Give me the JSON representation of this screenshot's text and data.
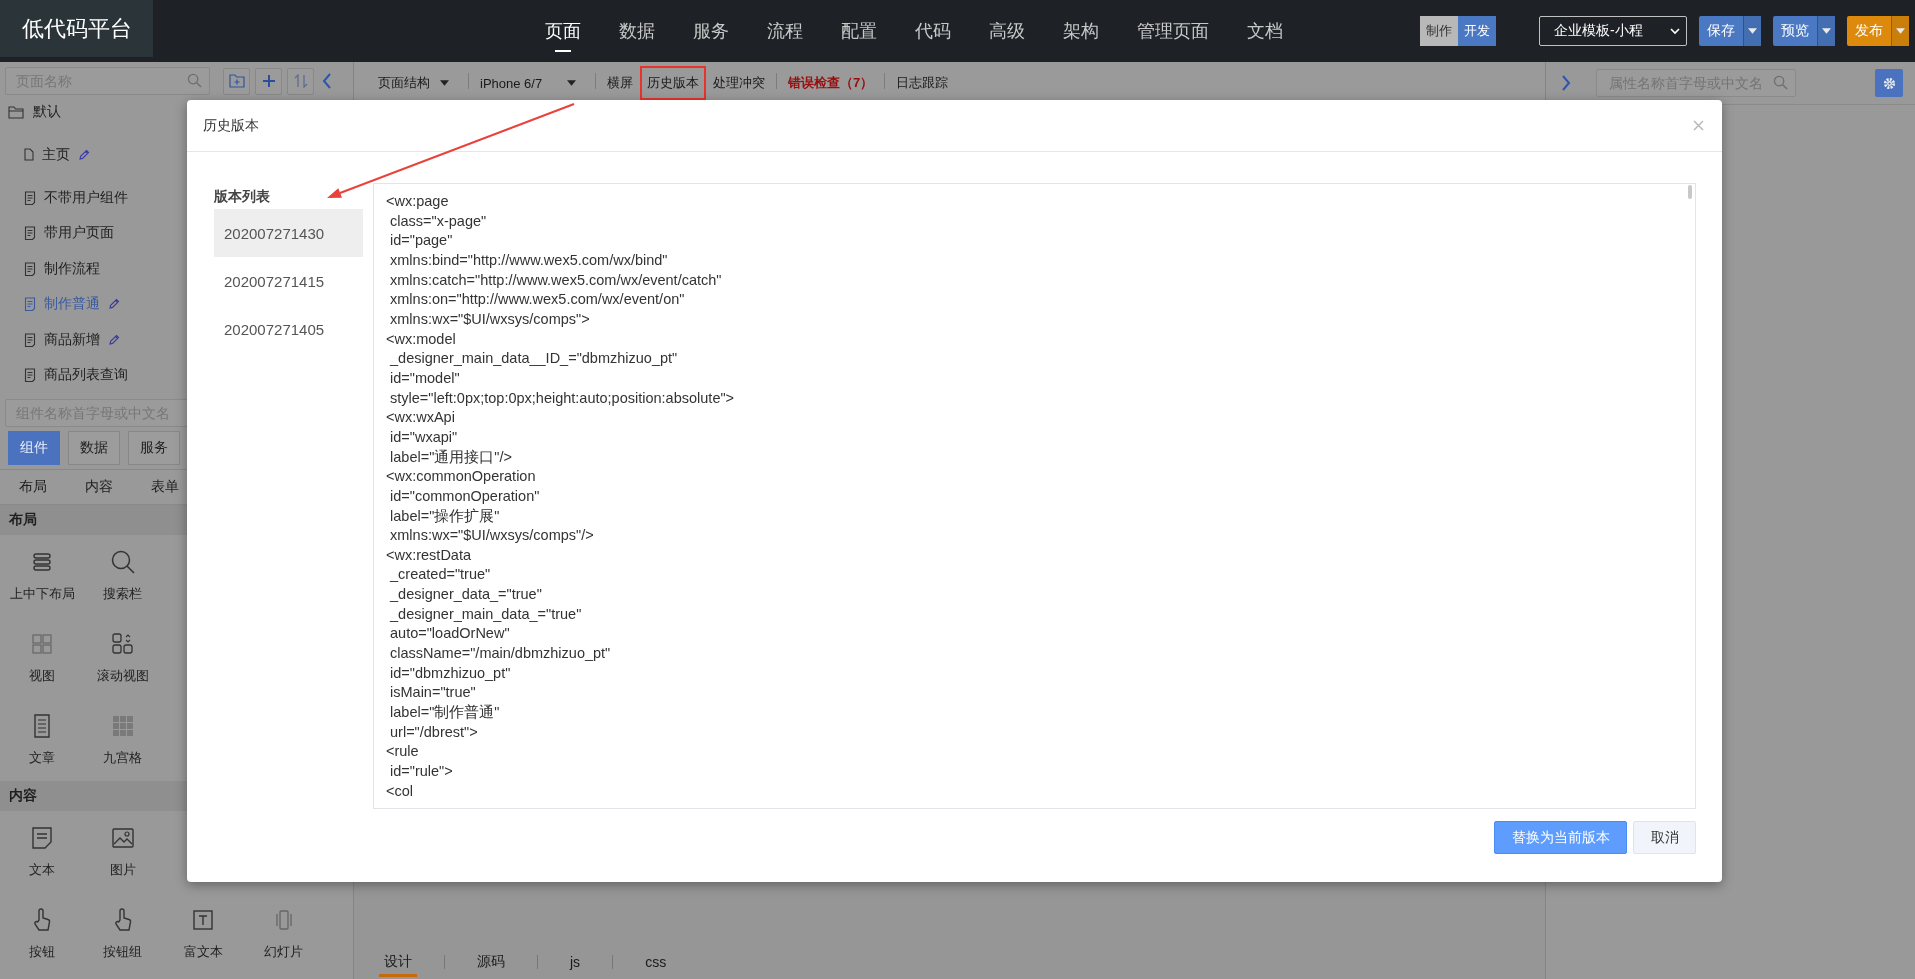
{
  "app": {
    "logo": "低代码平台"
  },
  "nav": [
    {
      "label": "页面",
      "selected": true
    },
    {
      "label": "数据",
      "selected": false
    },
    {
      "label": "服务",
      "selected": false
    },
    {
      "label": "流程",
      "selected": false
    },
    {
      "label": "配置",
      "selected": false
    },
    {
      "label": "代码",
      "selected": false
    },
    {
      "label": "高级",
      "selected": false
    },
    {
      "label": "架构",
      "selected": false
    },
    {
      "label": "管理页面",
      "selected": false
    },
    {
      "label": "文档",
      "selected": false
    }
  ],
  "mode_toggle": [
    {
      "label": "制作",
      "selected": false
    },
    {
      "label": "开发",
      "selected": true
    }
  ],
  "template_select": {
    "value": "企业模板-小程"
  },
  "actions": [
    {
      "label": "保存",
      "color": "#4a78c2"
    },
    {
      "label": "预览",
      "color": "#4a78c2"
    },
    {
      "label": "发布",
      "color": "#dd8a0c"
    }
  ],
  "page_panel": {
    "search": {
      "placeholder": "页面名称"
    },
    "tree": [
      {
        "label": "默认",
        "kind": "folder",
        "selected": false,
        "edit_mark": false,
        "children": [
          {
            "label": "主页",
            "kind": "home",
            "selected": false,
            "edit_mark": true
          },
          {
            "label": "不带用户组件",
            "kind": "page",
            "selected": false,
            "edit_mark": false
          },
          {
            "label": "带用户页面",
            "kind": "page",
            "selected": false,
            "edit_mark": false
          },
          {
            "label": "制作流程",
            "kind": "page",
            "selected": false,
            "edit_mark": false
          },
          {
            "label": "制作普通",
            "kind": "page",
            "selected": true,
            "edit_mark": true
          },
          {
            "label": "商品新增",
            "kind": "page",
            "selected": false,
            "edit_mark": true
          },
          {
            "label": "商品列表查询",
            "kind": "page",
            "selected": false,
            "edit_mark": false
          }
        ]
      }
    ]
  },
  "component_panel": {
    "search": {
      "placeholder": "组件名称首字母或中文名"
    },
    "tabs": [
      {
        "label": "组件",
        "selected": true
      },
      {
        "label": "数据",
        "selected": false
      },
      {
        "label": "服务",
        "selected": false
      }
    ],
    "categories": [
      "布局",
      "内容",
      "表单"
    ],
    "sections": [
      {
        "title": "布局",
        "rows": [
          [
            "上中下布局",
            "搜索栏"
          ],
          [
            "视图",
            "滚动视图"
          ],
          [
            "文章",
            "九宫格"
          ]
        ]
      },
      {
        "title": "内容",
        "rows": [
          [
            "文本",
            "图片"
          ],
          [
            "按钮",
            "按钮组",
            "富文本",
            "幻灯片"
          ]
        ]
      }
    ]
  },
  "toolbar": [
    {
      "label": "页面结构",
      "kind": "dropdown",
      "highlighted": false
    },
    {
      "label": "iPhone 6/7",
      "kind": "dropdown",
      "highlighted": false
    },
    {
      "label": "横屏",
      "kind": "plain",
      "highlighted": false
    },
    {
      "label": "历史版本",
      "kind": "plain",
      "highlighted": true
    },
    {
      "label": "处理冲突",
      "kind": "plain",
      "highlighted": false
    },
    {
      "label": "错误检查（7）",
      "kind": "error",
      "highlighted": false
    },
    {
      "label": "日志跟踪",
      "kind": "plain",
      "highlighted": false
    }
  ],
  "editor_tabs": [
    {
      "label": "设计",
      "selected": true
    },
    {
      "label": "源码",
      "selected": false
    },
    {
      "label": "js",
      "selected": false
    },
    {
      "label": "css",
      "selected": false
    }
  ],
  "property_panel": {
    "search": {
      "placeholder": "属性名称首字母或中文名"
    }
  },
  "dialog": {
    "title": "历史版本",
    "list_title": "版本列表",
    "versions": [
      {
        "label": "202007271430",
        "selected": true
      },
      {
        "label": "202007271415",
        "selected": false
      },
      {
        "label": "202007271405",
        "selected": false
      }
    ],
    "code_lines": [
      "<wx:page",
      " class=\"x-page\"",
      " id=\"page\"",
      " xmlns:bind=\"http://www.wex5.com/wx/bind\"",
      " xmlns:catch=\"http://www.wex5.com/wx/event/catch\"",
      " xmlns:on=\"http://www.wex5.com/wx/event/on\"",
      " xmlns:wx=\"$UI/wxsys/comps\">",
      "<wx:model",
      " _designer_main_data__ID_=\"dbmzhizuo_pt\"",
      " id=\"model\"",
      " style=\"left:0px;top:0px;height:auto;position:absolute\">",
      "<wx:wxApi",
      " id=\"wxapi\"",
      " label=\"通用接口\"/>",
      "<wx:commonOperation",
      " id=\"commonOperation\"",
      " label=\"操作扩展\"",
      " xmlns:wx=\"$UI/wxsys/comps\"/>",
      "<wx:restData",
      " _created=\"true\"",
      " _designer_data_=\"true\"",
      " _designer_main_data_=\"true\"",
      " auto=\"loadOrNew\"",
      " className=\"/main/dbmzhizuo_pt\"",
      " id=\"dbmzhizuo_pt\"",
      " isMain=\"true\"",
      " label=\"制作普通\"",
      " url=\"/dbrest\">",
      "<rule",
      " id=\"rule\">",
      "<col"
    ],
    "buttons": [
      {
        "label": "替换为当前版本",
        "kind": "primary"
      },
      {
        "label": "取消",
        "kind": "default"
      }
    ]
  }
}
